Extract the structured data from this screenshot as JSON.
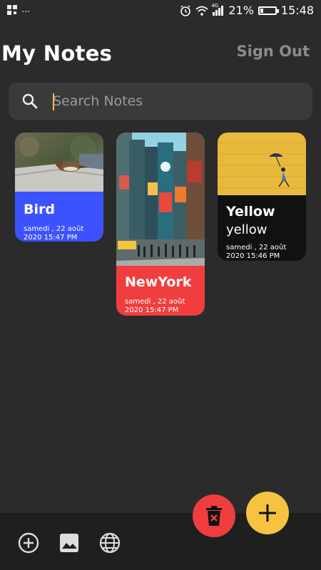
{
  "status_bar": {
    "dots": "...",
    "battery_percent": "21%",
    "battery_level": 0.21,
    "network": "4G",
    "time": "15:48"
  },
  "header": {
    "title": "My Notes",
    "sign_out_label": "Sign Out"
  },
  "search": {
    "placeholder": "Search Notes",
    "value": ""
  },
  "notes": [
    {
      "title": "Bird",
      "subtitle": "",
      "date_line1": "samedi , 22 août",
      "date_line2": "2020 15:47 PM",
      "color": "#3d52ff",
      "image": "bird"
    },
    {
      "title": "NewYork",
      "subtitle": "",
      "date_line1": "samedi , 22 août",
      "date_line2": "2020 15:47 PM",
      "color": "#f03e3e",
      "image": "city"
    },
    {
      "title": "Yellow",
      "subtitle": "yellow",
      "date_line1": "samedi , 22 août",
      "date_line2": "2020 15:46 PM",
      "color": "#111111",
      "image": "yellow-wall"
    }
  ],
  "bottom_bar": {
    "icons": [
      "add-circle-icon",
      "image-icon",
      "globe-icon"
    ]
  },
  "fabs": {
    "delete_color": "#f03e3e",
    "add_color": "#f5c242"
  }
}
